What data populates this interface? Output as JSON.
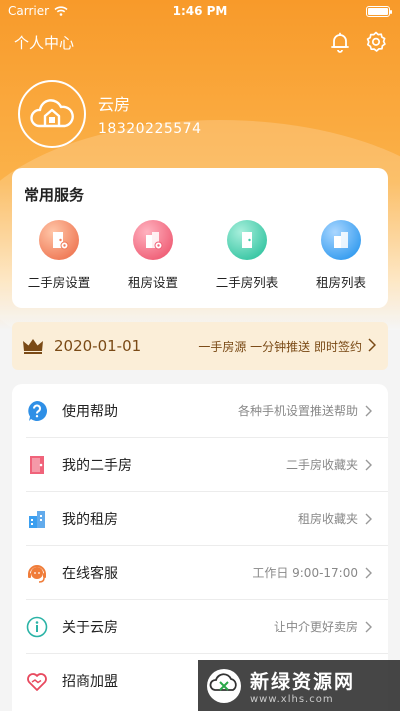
{
  "status_bar": {
    "carrier": "Carrier",
    "time": "1:46 PM"
  },
  "nav": {
    "title": "个人中心",
    "icons": [
      "bell-icon",
      "gear-icon"
    ]
  },
  "profile": {
    "name": "云房",
    "phone": "18320225574",
    "avatar_icon": "cloud-house-icon"
  },
  "services": {
    "title": "常用服务",
    "items": [
      {
        "label": "二手房设置",
        "icon": "door-settings-icon",
        "color": "#f07d5a"
      },
      {
        "label": "租房设置",
        "icon": "building-settings-icon",
        "color": "#f0637a"
      },
      {
        "label": "二手房列表",
        "icon": "door-icon",
        "color": "#3ec8a6"
      },
      {
        "label": "租房列表",
        "icon": "building-icon",
        "color": "#3b9ff0"
      }
    ]
  },
  "vip_bar": {
    "date": "2020-01-01",
    "promo": "一手房源 一分钟推送 即时签约",
    "icon": "crown-icon"
  },
  "menu": {
    "items": [
      {
        "label": "使用帮助",
        "sub": "各种手机设置推送帮助",
        "icon": "help-icon"
      },
      {
        "label": "我的二手房",
        "sub": "二手房收藏夹",
        "icon": "door-icon"
      },
      {
        "label": "我的租房",
        "sub": "租房收藏夹",
        "icon": "building-icon"
      },
      {
        "label": "在线客服",
        "sub": "工作日 9:00-17:00",
        "icon": "headset-icon"
      },
      {
        "label": "关于云房",
        "sub": "让中介更好卖房",
        "icon": "info-icon"
      },
      {
        "label": "招商加盟",
        "sub": "",
        "icon": "handshake-icon"
      }
    ]
  },
  "watermark": {
    "name": "新绿资源网",
    "url": "www.xlhs.com"
  },
  "colors": {
    "accent": "#f89a2a",
    "vip_bg": "#fbeed8",
    "vip_text": "#7a4a16"
  }
}
